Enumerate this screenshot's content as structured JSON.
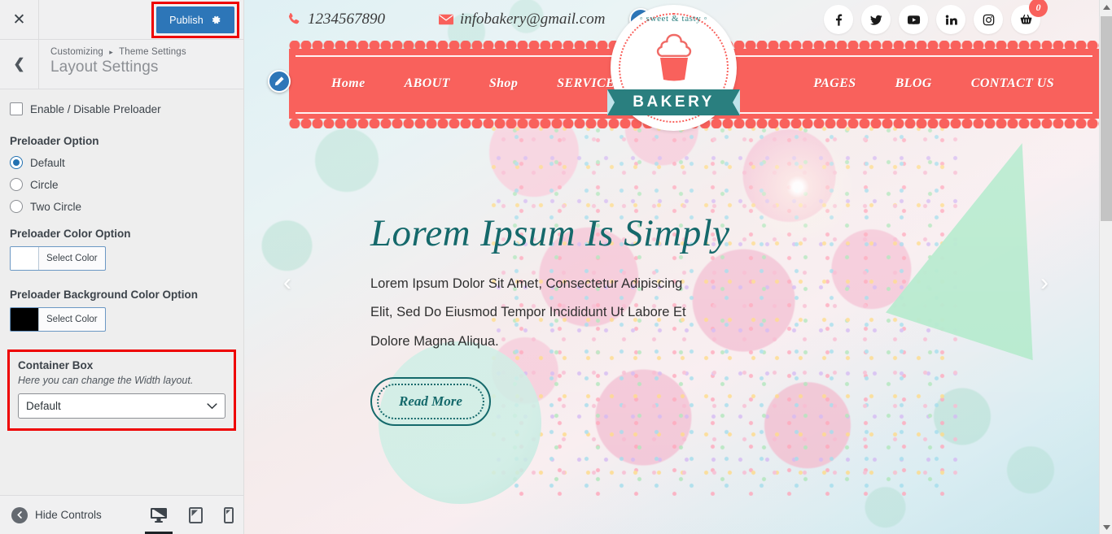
{
  "customizer": {
    "close_icon": "close-icon",
    "publish_label": "Publish",
    "publish_gear_icon": "gear-icon",
    "back_icon": "chevron-left-icon",
    "breadcrumb_root": "Customizing",
    "breadcrumb_sep": "▸",
    "breadcrumb_section": "Theme Settings",
    "panel_title": "Layout Settings",
    "preloader_toggle_label": "Enable / Disable Preloader",
    "preloader_option_title": "Preloader Option",
    "preloader_options": [
      {
        "label": "Default",
        "selected": true
      },
      {
        "label": "Circle",
        "selected": false
      },
      {
        "label": "Two Circle",
        "selected": false
      }
    ],
    "preloader_color_title": "Preloader Color Option",
    "preloader_color_button": "Select Color",
    "preloader_color_value": "#ffffff",
    "preloader_bg_title": "Preloader Background Color Option",
    "preloader_bg_button": "Select Color",
    "preloader_bg_value": "#000000",
    "container_box_title": "Container Box",
    "container_box_desc": "Here you can change the Width layout.",
    "container_box_value": "Default",
    "container_box_chevron": "chevron-down-icon",
    "highlight_color": "#ee0000",
    "accent_color": "#2d76b8",
    "hide_controls_label": "Hide Controls",
    "hide_controls_icon": "collapse-left-icon",
    "devices": [
      {
        "name": "desktop",
        "icon": "desktop-icon",
        "active": true
      },
      {
        "name": "tablet",
        "icon": "tablet-icon",
        "active": false
      },
      {
        "name": "mobile",
        "icon": "mobile-icon",
        "active": false
      }
    ]
  },
  "preview": {
    "topbar": {
      "phone": "1234567890",
      "phone_icon": "phone-icon",
      "email": "infobakery@gmail.com",
      "email_icon": "envelope-icon",
      "edit_icon": "pencil-edit-icon",
      "socials": [
        {
          "name": "facebook",
          "icon": "facebook-icon"
        },
        {
          "name": "twitter",
          "icon": "twitter-icon"
        },
        {
          "name": "youtube",
          "icon": "youtube-icon"
        },
        {
          "name": "linkedin",
          "icon": "linkedin-icon"
        },
        {
          "name": "instagram",
          "icon": "instagram-icon"
        }
      ],
      "cart_icon": "shopping-basket-icon",
      "cart_count": "0"
    },
    "logo": {
      "tagline": "◦ sweet & tasty ◦",
      "name": "BAKERY",
      "mark": "cupcake-icon",
      "ribbon_color": "#2a7f7f",
      "accent_color": "#f9615c"
    },
    "nav": {
      "edit_icon": "pencil-edit-icon",
      "bar_color": "#f9615c",
      "items_left": [
        "Home",
        "ABOUT",
        "Shop",
        "SERVICES"
      ],
      "items_right": [
        "PAGES",
        "BLOG",
        "CONTACT US"
      ]
    },
    "hero": {
      "heading": "Lorem Ipsum Is Simply",
      "body": "Lorem Ipsum Dolor Sit Amet, Consectetur Adipiscing Elit, Sed Do Eiusmod Tempor Incididunt Ut Labore Et Dolore Magna Aliqua.",
      "button_label": "Read More",
      "heading_color": "#15696b",
      "prev_arrow": "‹",
      "next_arrow": "›"
    },
    "scrollbar": {
      "up_icon": "scroll-up-icon",
      "down_icon": "scroll-down-icon"
    }
  }
}
